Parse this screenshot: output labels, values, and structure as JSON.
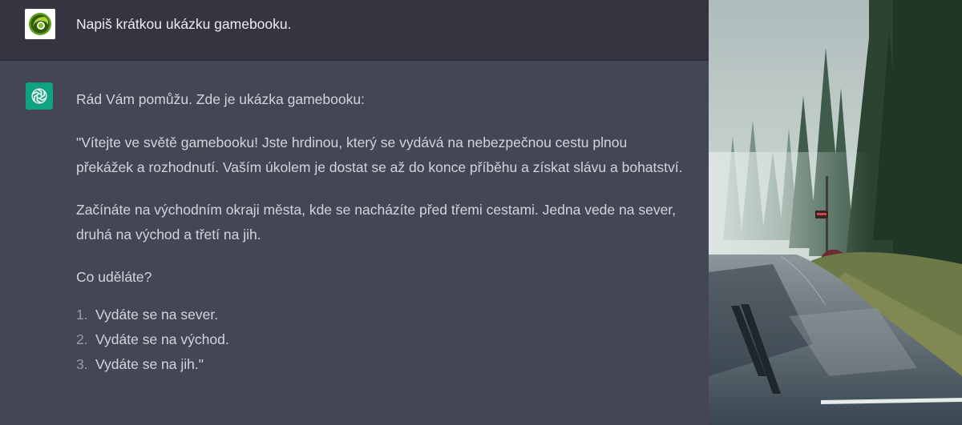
{
  "user_message": {
    "avatar_icon": "user-avatar-icon",
    "text": "Napiš krátkou ukázku gamebooku."
  },
  "assistant_message": {
    "avatar_icon": "openai-logo-icon",
    "intro": "Rád Vám pomůžu. Zde je ukázka gamebooku:",
    "paragraph_1": "\"Vítejte ve světě gamebooku! Jste hrdinou, který se vydává na nebezpečnou cestu plnou překážek a rozhodnutí. Vaším úkolem je dostat se až do konce příběhu a získat slávu a bohatství.",
    "paragraph_2": "Začínáte na východním okraji města, kde se nacházíte před třemi cestami. Jedna vede na sever, druhá na východ a třetí na jih.",
    "question": "Co uděláte?",
    "options": [
      {
        "num": "1.",
        "text": "Vydáte se na sever."
      },
      {
        "num": "2.",
        "text": "Vydáte se na východ."
      },
      {
        "num": "3.",
        "text": "Vydáte se na jih.\""
      }
    ]
  },
  "colors": {
    "user_bg": "#343541",
    "assistant_bg": "#444654",
    "assistant_avatar": "#10a37f",
    "text": "#d1d5db"
  }
}
